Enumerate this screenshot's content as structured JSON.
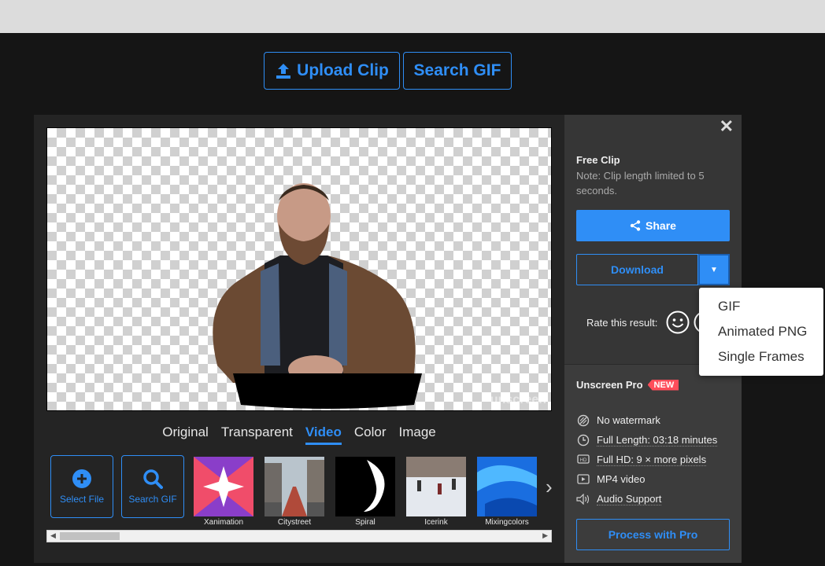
{
  "toolbar": {
    "upload_label": "Upload Clip",
    "search_gif_label": "Search GIF"
  },
  "preview": {
    "watermark": "unscreen"
  },
  "view_tabs": [
    "Original",
    "Transparent",
    "Video",
    "Color",
    "Image"
  ],
  "active_view_tab": "Video",
  "background_picker": {
    "actions": [
      {
        "label": "Select File",
        "icon": "plus-circle-icon"
      },
      {
        "label": "Search GIF",
        "icon": "search-icon"
      }
    ],
    "thumbnails": [
      "Xanimation",
      "Citystreet",
      "Spiral",
      "Icerink",
      "Mixingcolors"
    ]
  },
  "side_panel": {
    "free_title": "Free Clip",
    "free_note": "Note: Clip length limited to 5 seconds.",
    "share_label": "Share",
    "download_label": "Download",
    "rate_label": "Rate this result:",
    "pro_title": "Unscreen Pro",
    "new_badge": "NEW",
    "features": [
      {
        "text": "No watermark",
        "icon": "no-watermark-icon"
      },
      {
        "text": "Full Length: 03:18 minutes",
        "icon": "clock-icon"
      },
      {
        "text": "Full HD: 9 × more pixels",
        "icon": "hd-icon"
      },
      {
        "text": "MP4 video",
        "icon": "play-icon"
      },
      {
        "text": "Audio Support",
        "icon": "speaker-icon"
      }
    ],
    "pro_button_label": "Process with Pro"
  },
  "download_menu": [
    "GIF",
    "Animated PNG",
    "Single Frames"
  ],
  "colors": {
    "accent": "#2f8ef6",
    "badge": "#ff4d5a"
  }
}
